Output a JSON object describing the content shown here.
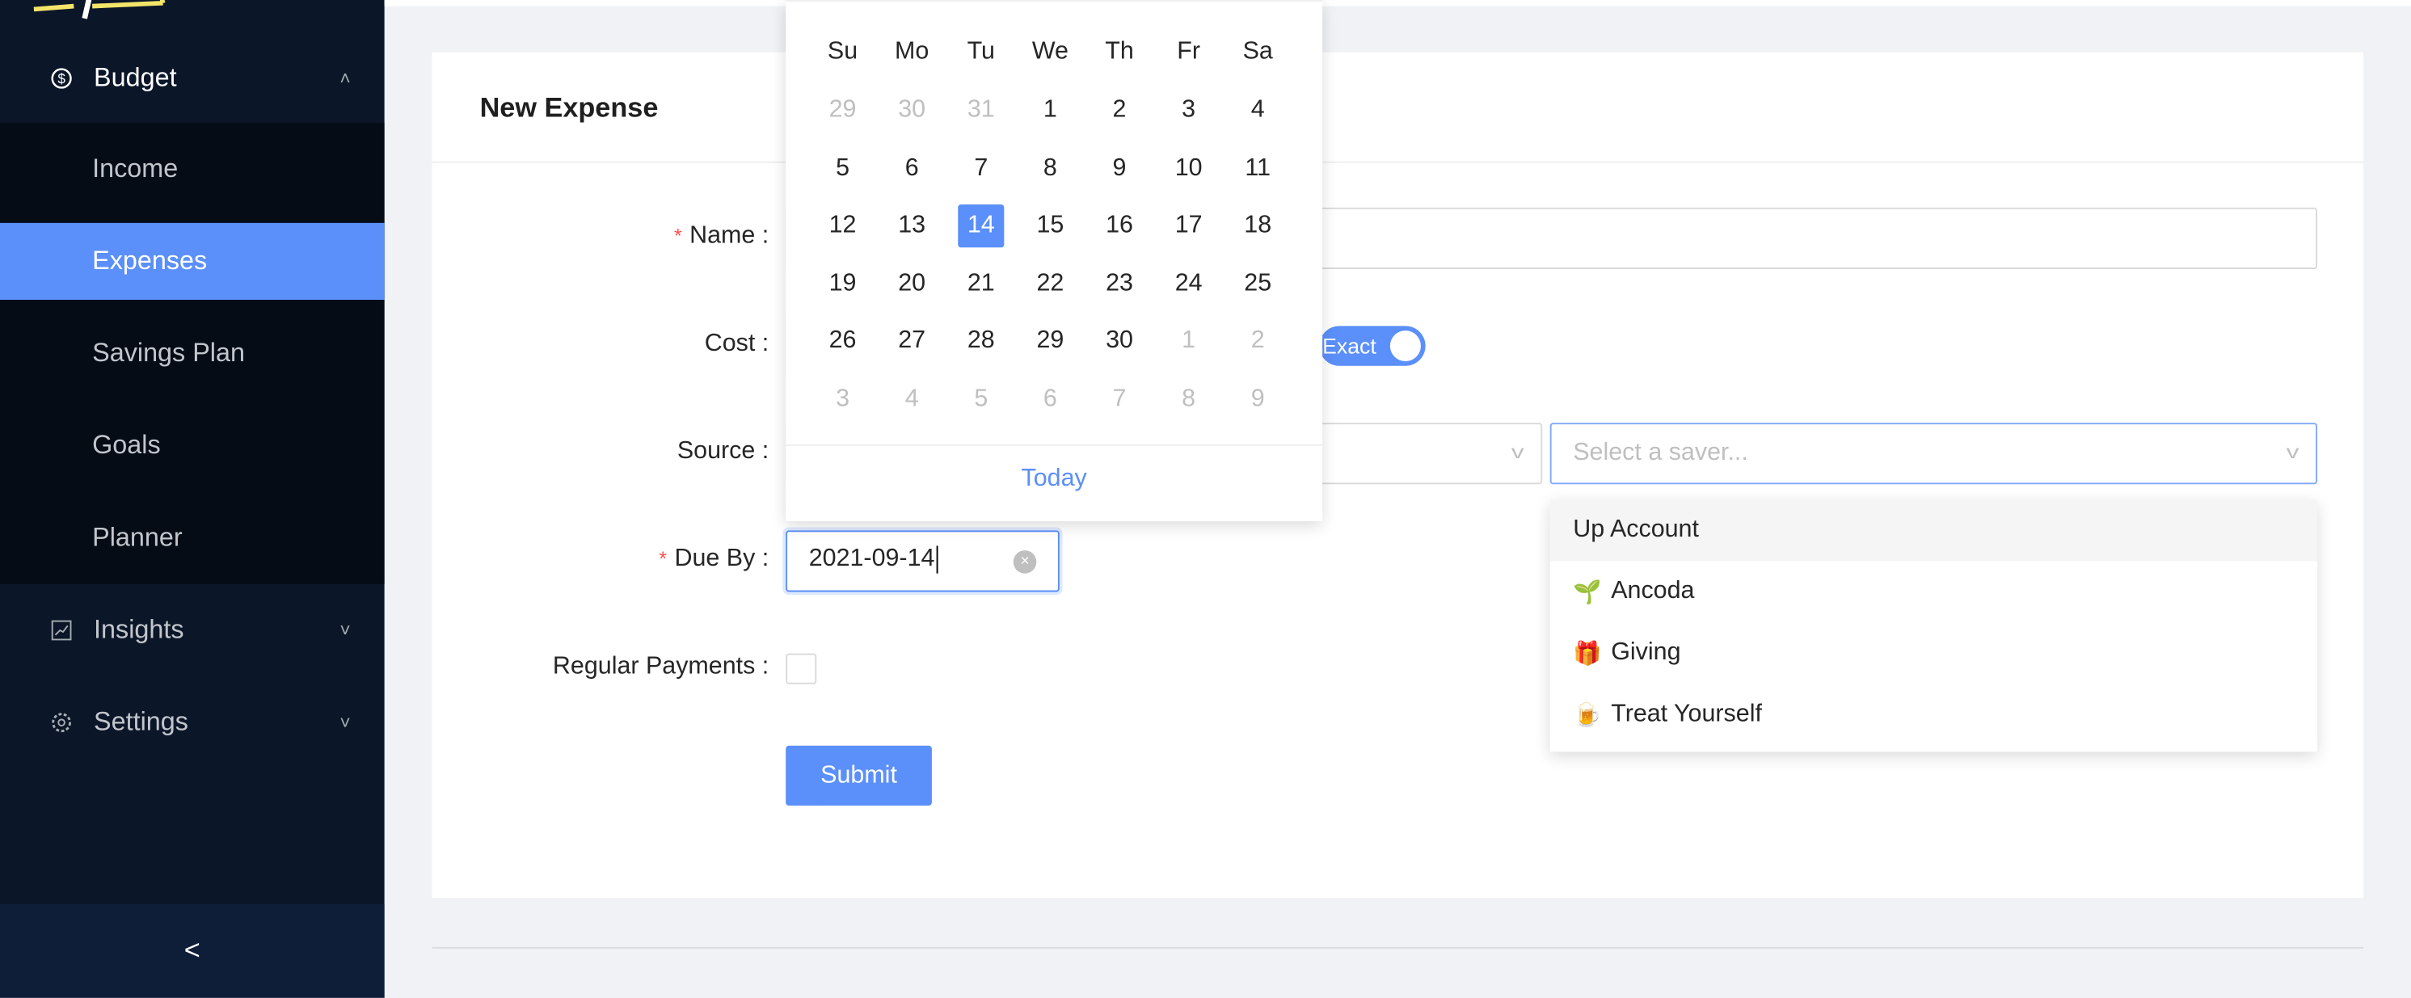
{
  "sidebar": {
    "budget": "Budget",
    "items": [
      {
        "label": "Income"
      },
      {
        "label": "Expenses",
        "selected": true
      },
      {
        "label": "Savings Plan"
      },
      {
        "label": "Goals"
      },
      {
        "label": "Planner"
      }
    ],
    "insights": "Insights",
    "settings": "Settings",
    "collapse": "<"
  },
  "card": {
    "title": "New Expense"
  },
  "form": {
    "name_label": "Name",
    "cost_label": "Cost",
    "exact_toggle": "Exact",
    "source_label": "Source",
    "saver_placeholder": "Select a saver...",
    "due_label": "Due By",
    "due_value": "2021-09-14",
    "regular_label": "Regular Payments",
    "submit": "Submit"
  },
  "calendar": {
    "weekdays": [
      "Su",
      "Mo",
      "Tu",
      "We",
      "Th",
      "Fr",
      "Sa"
    ],
    "weeks": [
      [
        "29",
        "30",
        "31",
        "1",
        "2",
        "3",
        "4"
      ],
      [
        "5",
        "6",
        "7",
        "8",
        "9",
        "10",
        "11"
      ],
      [
        "12",
        "13",
        "14",
        "15",
        "16",
        "17",
        "18"
      ],
      [
        "19",
        "20",
        "21",
        "22",
        "23",
        "24",
        "25"
      ],
      [
        "26",
        "27",
        "28",
        "29",
        "30",
        "1",
        "2"
      ],
      [
        "3",
        "4",
        "5",
        "6",
        "7",
        "8",
        "9"
      ]
    ],
    "selected": "14",
    "today": "Today"
  },
  "saver_options": [
    {
      "label": "Up Account",
      "icon": ""
    },
    {
      "label": "Ancoda",
      "icon": "🌱"
    },
    {
      "label": "Giving",
      "icon": "🎁"
    },
    {
      "label": "Treat Yourself",
      "icon": "🍺"
    }
  ],
  "colors": {
    "accent": "#5b8ff9",
    "sidebar": "#0b1628",
    "required": "#ff4d4f"
  }
}
